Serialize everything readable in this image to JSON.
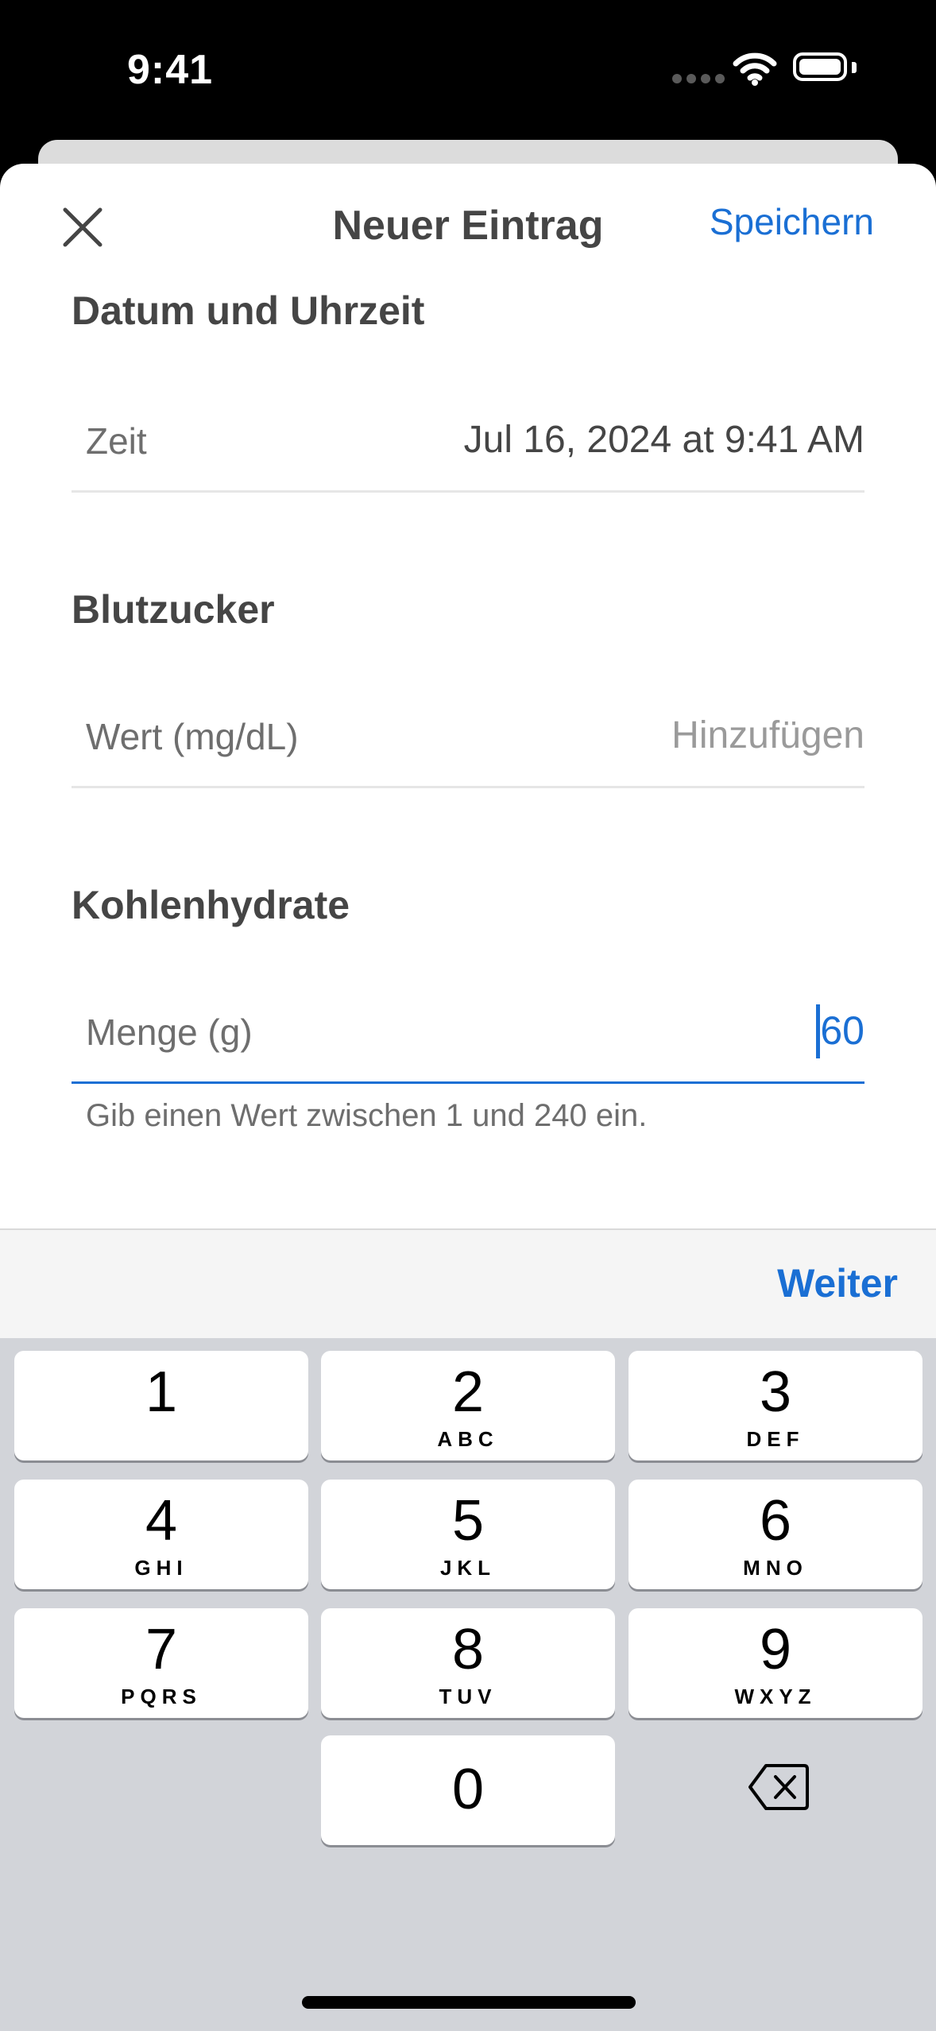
{
  "status_bar": {
    "time": "9:41"
  },
  "nav": {
    "title": "Neuer Eintrag",
    "save_label": "Speichern"
  },
  "sections": {
    "datetime": {
      "title": "Datum und Uhrzeit",
      "field_label": "Zeit",
      "field_value": "Jul 16, 2024 at 9:41 AM"
    },
    "glucose": {
      "title": "Blutzucker",
      "field_label": "Wert (mg/dL)",
      "field_placeholder": "Hinzufügen"
    },
    "carbs": {
      "title": "Kohlenhydrate",
      "field_label": "Menge (g)",
      "field_value": "60",
      "hint": "Gib einen Wert zwischen 1 und 240 ein."
    }
  },
  "accessory": {
    "next_label": "Weiter"
  },
  "keyboard": {
    "keys": [
      {
        "digit": "1",
        "letters": ""
      },
      {
        "digit": "2",
        "letters": "ABC"
      },
      {
        "digit": "3",
        "letters": "DEF"
      },
      {
        "digit": "4",
        "letters": "GHI"
      },
      {
        "digit": "5",
        "letters": "JKL"
      },
      {
        "digit": "6",
        "letters": "MNO"
      },
      {
        "digit": "7",
        "letters": "PQRS"
      },
      {
        "digit": "8",
        "letters": "TUV"
      },
      {
        "digit": "9",
        "letters": "WXYZ"
      },
      {
        "digit": "0",
        "letters": ""
      }
    ]
  },
  "colors": {
    "accent": "#1a6fd4",
    "text_primary": "#454545",
    "text_secondary": "#6e6e6e",
    "keyboard_bg": "#d2d4d9"
  }
}
